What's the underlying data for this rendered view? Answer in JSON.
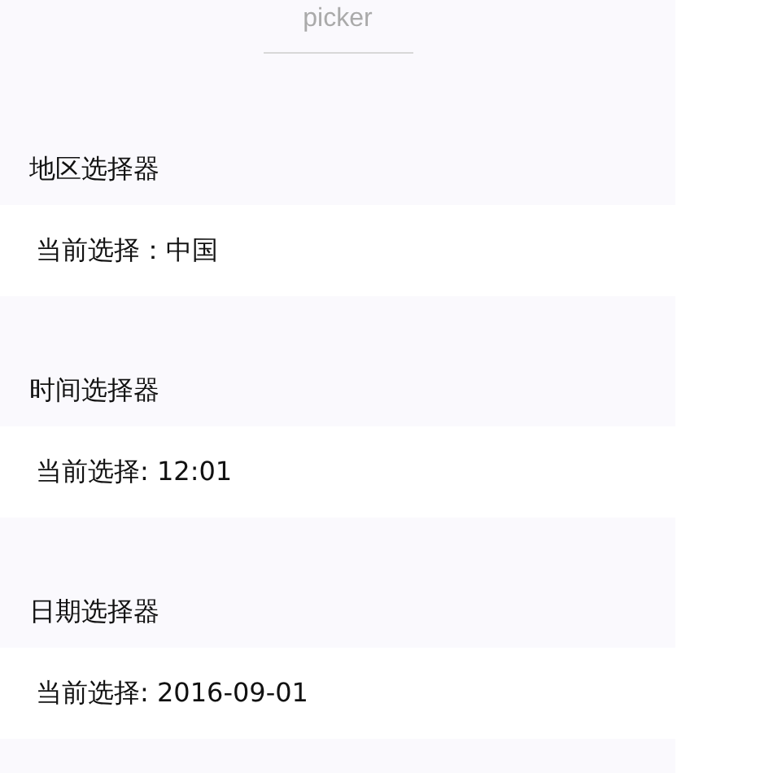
{
  "header": {
    "title": "picker"
  },
  "sections": [
    {
      "title": "地区选择器",
      "value": "当前选择：中国"
    },
    {
      "title": "时间选择器",
      "value": "当前选择: 12:01"
    },
    {
      "title": "日期选择器",
      "value": "当前选择: 2016-09-01"
    }
  ]
}
